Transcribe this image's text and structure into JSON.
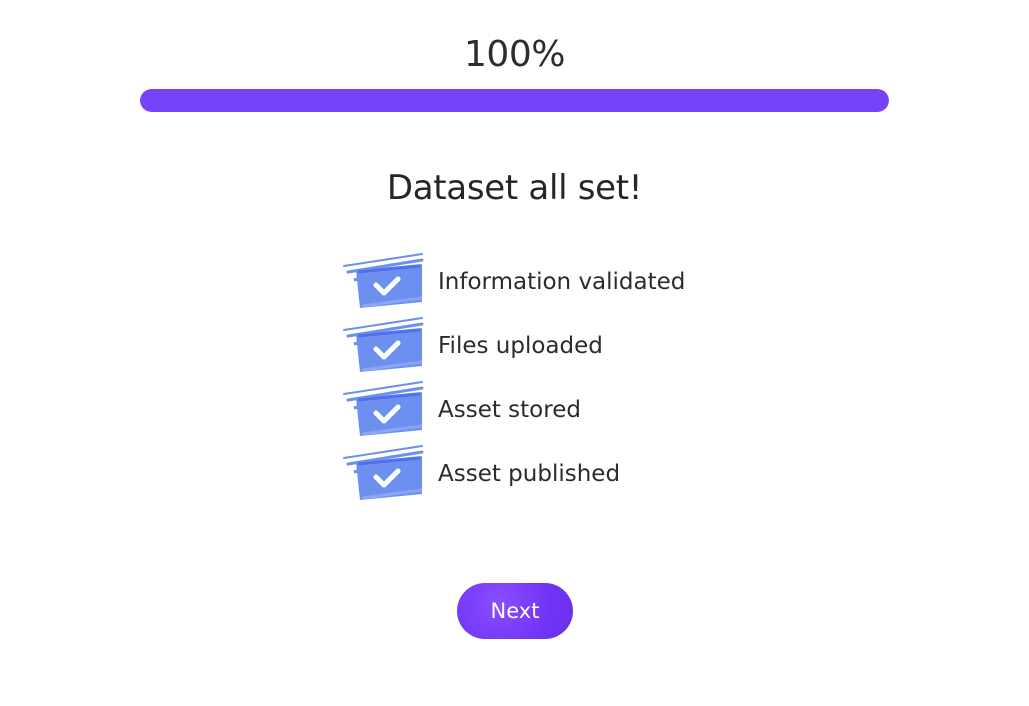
{
  "progress": {
    "label": "100%",
    "value": 1.0,
    "fill_color": "#7443fa"
  },
  "heading": "Dataset all set!",
  "steps": [
    {
      "label": "Information validated",
      "icon": "checkbox-checked-icon",
      "done": true
    },
    {
      "label": "Files uploaded",
      "icon": "checkbox-checked-icon",
      "done": true
    },
    {
      "label": "Asset stored",
      "icon": "checkbox-checked-icon",
      "done": true
    },
    {
      "label": "Asset published",
      "icon": "checkbox-checked-icon",
      "done": true
    }
  ],
  "colors": {
    "accent": "#7443fa",
    "check_box": "#6d8ff0"
  },
  "next_button": {
    "label": "Next"
  }
}
